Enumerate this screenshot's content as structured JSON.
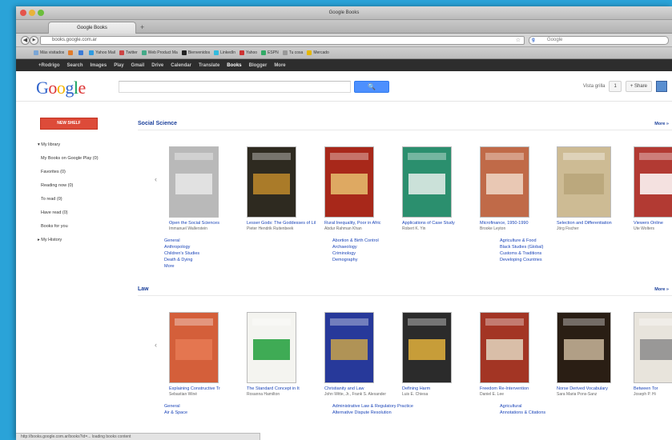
{
  "window": {
    "title": "Google Books"
  },
  "browser": {
    "tab_label": "Google Books",
    "new_tab": "+",
    "back": "◀",
    "url": "books.google.com.ar",
    "search_engine": "g",
    "search_placeholder": "Google",
    "bookmarks": [
      "Más visitados",
      "",
      "",
      "Yahoo Mail",
      "Twitter",
      "Web Product Ma",
      "Bienvenidos",
      "LinkedIn",
      "Yahoo",
      "ESPN",
      "Tu cosa",
      "Mercado"
    ]
  },
  "gbar": {
    "items": [
      "+Rodrigo",
      "Search",
      "Images",
      "Play",
      "Gmail",
      "Drive",
      "Calendar",
      "Translate",
      "Books",
      "Blogger",
      "More"
    ],
    "active": "Books"
  },
  "header": {
    "logo": [
      {
        "ch": "G",
        "color": "#3366cc"
      },
      {
        "ch": "o",
        "color": "#dd3333"
      },
      {
        "ch": "o",
        "color": "#f4b400"
      },
      {
        "ch": "g",
        "color": "#3366cc"
      },
      {
        "ch": "l",
        "color": "#109d59"
      },
      {
        "ch": "e",
        "color": "#dd3333"
      }
    ],
    "search_button": "🔍",
    "right_label": "Vista grilla",
    "page_button": "1",
    "share_button": "+ Share"
  },
  "sidebar": {
    "new_shelf": "NEW SHELF",
    "items": [
      "▾ My library",
      "My Books on Google Play (0)",
      "Favorites (0)",
      "Reading now (0)",
      "To read (0)",
      "Have read (0)",
      "Books for you",
      "▸ My History"
    ]
  },
  "sections": [
    {
      "title": "Social Science",
      "more": "More »",
      "books": [
        {
          "title": "Open the Social Sciences",
          "author": "Immanuel Wallerstein",
          "bg": "#b9b9b9",
          "band": "#e8e8e8"
        },
        {
          "title": "Lesser Gods: The Goddesses of Lil",
          "author": "Pieter Hendrik Ruitenbeek",
          "bg": "#2e2a20",
          "band": "#c0892b"
        },
        {
          "title": "Rural Inequality, Poor in Afric",
          "author": "Abdur Rahman Khan",
          "bg": "#a8281a",
          "band": "#e8c070"
        },
        {
          "title": "Applications of Case Study",
          "author": "Robert K. Yin",
          "bg": "#2b8f6e",
          "band": "#e8f0ec"
        },
        {
          "title": "Microfinance, 1950-1990",
          "author": "Brooke Leyton",
          "bg": "#c06a48",
          "band": "#f0d8c8"
        },
        {
          "title": "Selection and Differentiation",
          "author": "Jörg Fischer",
          "bg": "#cdbb94",
          "band": "#b7a479"
        },
        {
          "title": "Viewers Online",
          "author": "Ute Wolters",
          "bg": "#b23a33",
          "band": "#ffffff"
        }
      ],
      "categories": [
        [
          "General",
          "Anthropology",
          "Children's Studies",
          "Death & Dying",
          "More"
        ],
        [
          "Abortion & Birth Control",
          "Archaeology",
          "Criminology",
          "Demography"
        ],
        [
          "Agriculture & Food",
          "Black Studies (Global)",
          "Customs & Traditions",
          "Developing Countries"
        ]
      ]
    },
    {
      "title": "Law",
      "more": "More »",
      "books": [
        {
          "title": "Explaining Constructive Tr",
          "author": "Sebastian Winé",
          "bg": "#d45f3a",
          "band": "#e67a55"
        },
        {
          "title": "The Standard Concept in It",
          "author": "Rosanna Hamilton",
          "bg": "#f4f4f0",
          "band": "#1f9d3a"
        },
        {
          "title": "Christianity and Law",
          "author": "John Witte, Jr., Frank S. Alexander",
          "bg": "#27399a",
          "band": "#c9a34a"
        },
        {
          "title": "Defining Harm",
          "author": "Luis E. Chiesa",
          "bg": "#2b2b2b",
          "band": "#e3b23c"
        },
        {
          "title": "Freedom Re-Intervention",
          "author": "Daniel E. Lee",
          "bg": "#a33524",
          "band": "#e3d6c0"
        },
        {
          "title": "Norse Derived Vocabulary",
          "author": "Sara Maria Pons-Sanz",
          "bg": "#2a1e14",
          "band": "#c9b69a"
        },
        {
          "title": "Between Tor",
          "author": "Joseph P. Hi",
          "bg": "#e8e4dc",
          "band": "#8b8b8b"
        }
      ],
      "categories": [
        [
          "General",
          "Air & Space"
        ],
        [
          "Administrative Law & Regulatory Practice",
          "Alternative Dispute Resolution"
        ],
        [
          "Agricultural",
          "Annotations & Citations"
        ]
      ]
    }
  ],
  "status": "http://books.google.com.ar/books?id=... loading books content",
  "colors": {
    "gbar_bg": "#2d2d2d",
    "link": "#1a44b8",
    "section": "#1a3f9b",
    "new_shelf": "#dd4b39",
    "search_btn": "#4d90fe"
  }
}
